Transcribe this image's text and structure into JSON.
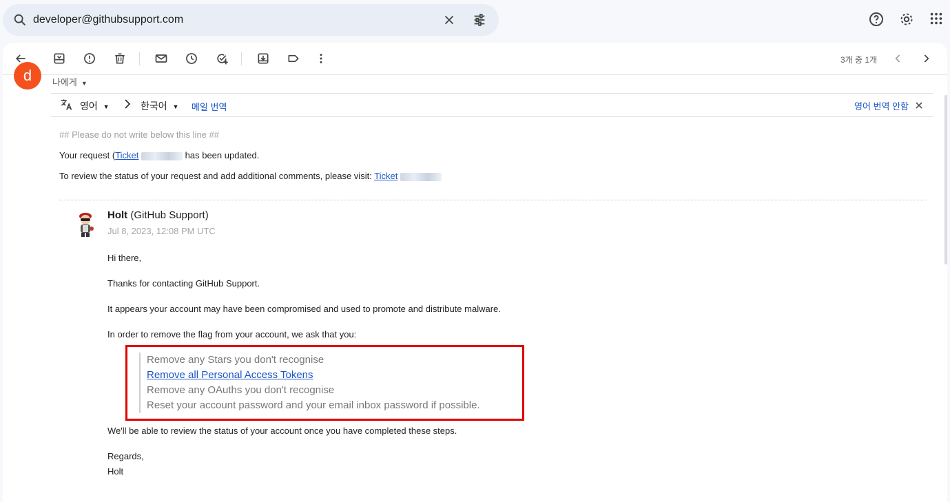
{
  "search": {
    "query": "developer@githubsupport.com"
  },
  "icons": {
    "search": "search-icon",
    "clear": "close-icon",
    "tune": "tune-icon",
    "help": "help-icon",
    "settings": "gear-icon",
    "apps": "apps-grid-icon"
  },
  "toolbar": {
    "pager": "3개 중 1개"
  },
  "message": {
    "sender_initial": "d",
    "recipient_label": "나에게",
    "translate": {
      "source_lang": "영어",
      "target_lang": "한국어",
      "translate_message": "메일 번역",
      "dont_translate": "영어 번역 안함"
    },
    "header_note": "## Please do not write below this line ##",
    "request_prefix": "Your request (",
    "request_link": "Ticket",
    "request_suffix": "has been updated.",
    "review_prefix": "To review the status of your request and add additional comments, please visit: ",
    "review_link": "Ticket"
  },
  "reply": {
    "sender_name": "Holt",
    "sender_org": "(GitHub Support)",
    "date": "Jul 8, 2023, 12:08 PM UTC",
    "greeting": "Hi there,",
    "thanks": "Thanks for contacting GitHub Support.",
    "p1": "It appears your account may have been compromised and used to promote and distribute malware.",
    "p2": "In order to remove the flag from your account, we ask that you:",
    "steps": [
      "Remove any Stars you don't recognise",
      "Remove all Personal Access Tokens",
      "Remove any OAuths you don't recognise",
      "Reset your account password and your email inbox password if possible."
    ],
    "p3": "We'll be able to review the status of your account once you have completed these steps.",
    "signoff": "Regards,",
    "signature": "Holt"
  },
  "colors": {
    "highlight_border": "#e00000",
    "link": "#1a56c8",
    "avatar_bg": "#f4511e"
  }
}
